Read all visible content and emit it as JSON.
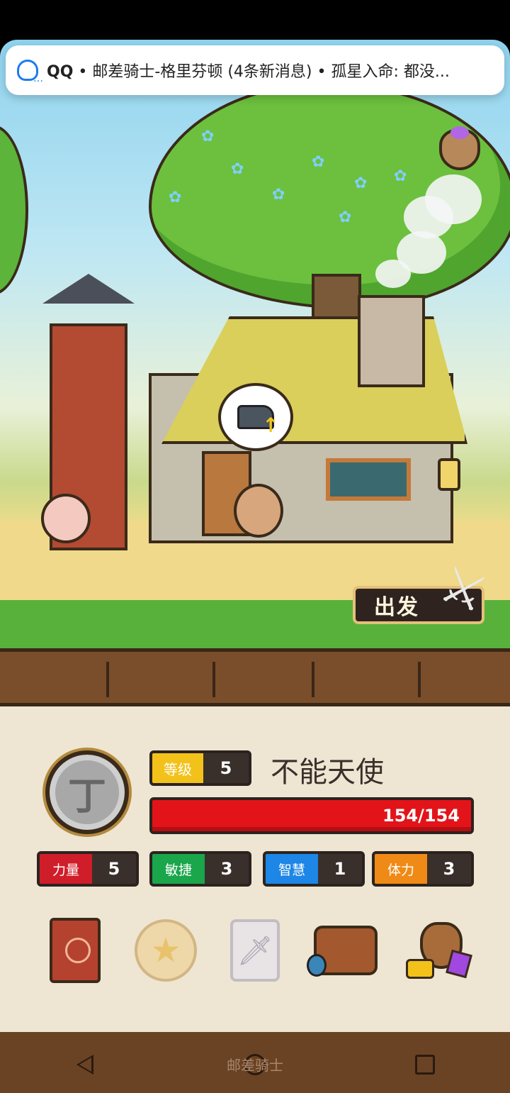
{
  "notification": {
    "app": "QQ",
    "separator": "•",
    "message": "邮差骑士-格里芬顿 (4条新消息) • 孤星入命: 都没..."
  },
  "scene": {
    "depart_button_label": "出发"
  },
  "player": {
    "level_label": "等级",
    "level_value": "5",
    "name": "不能天使",
    "coin_glyph": "丁",
    "hp_text": "154/154",
    "hp_fraction": 1.0
  },
  "stats": [
    {
      "label": "力量",
      "value": "5",
      "color": "#cf1e2a"
    },
    {
      "label": "敏捷",
      "value": "3",
      "color": "#1aa64a"
    },
    {
      "label": "智慧",
      "value": "1",
      "color": "#1e86e6"
    },
    {
      "label": "体力",
      "value": "3",
      "color": "#f08a16"
    }
  ],
  "menu": [
    "hero-book-icon",
    "star-coin-icon",
    "card-deck-icon",
    "inventory-bag-icon",
    "treasure-icon"
  ],
  "navbar": {
    "app_label": "邮差骑士"
  }
}
